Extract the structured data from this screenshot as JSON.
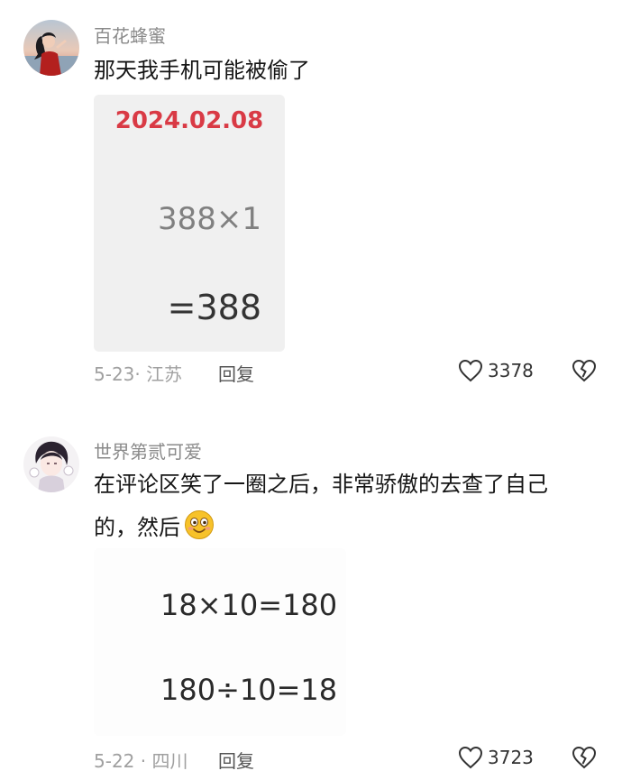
{
  "comments": [
    {
      "username": "百花蜂蜜",
      "text": "那天我手机可能被偷了",
      "image": {
        "date": "2024.02.08",
        "line1": "388×1",
        "line2": "=388"
      },
      "date_location": "5-23· 江苏",
      "reply_label": "回复",
      "likes": "3378"
    },
    {
      "username": "世界第贰可爱",
      "text_line1": "在评论区笑了一圈之后，非常骄傲的去查了自己",
      "text_line2": "的，然后",
      "emoji": "smiling-face-emoji",
      "image": {
        "line1": "18×10=180",
        "line2": "180÷10=18"
      },
      "date_location": "5-22 · 四川",
      "reply_label": "回复",
      "likes": "3723"
    }
  ],
  "colors": {
    "date_red": "#d93a45",
    "card_bg": "#f0f0f0"
  }
}
